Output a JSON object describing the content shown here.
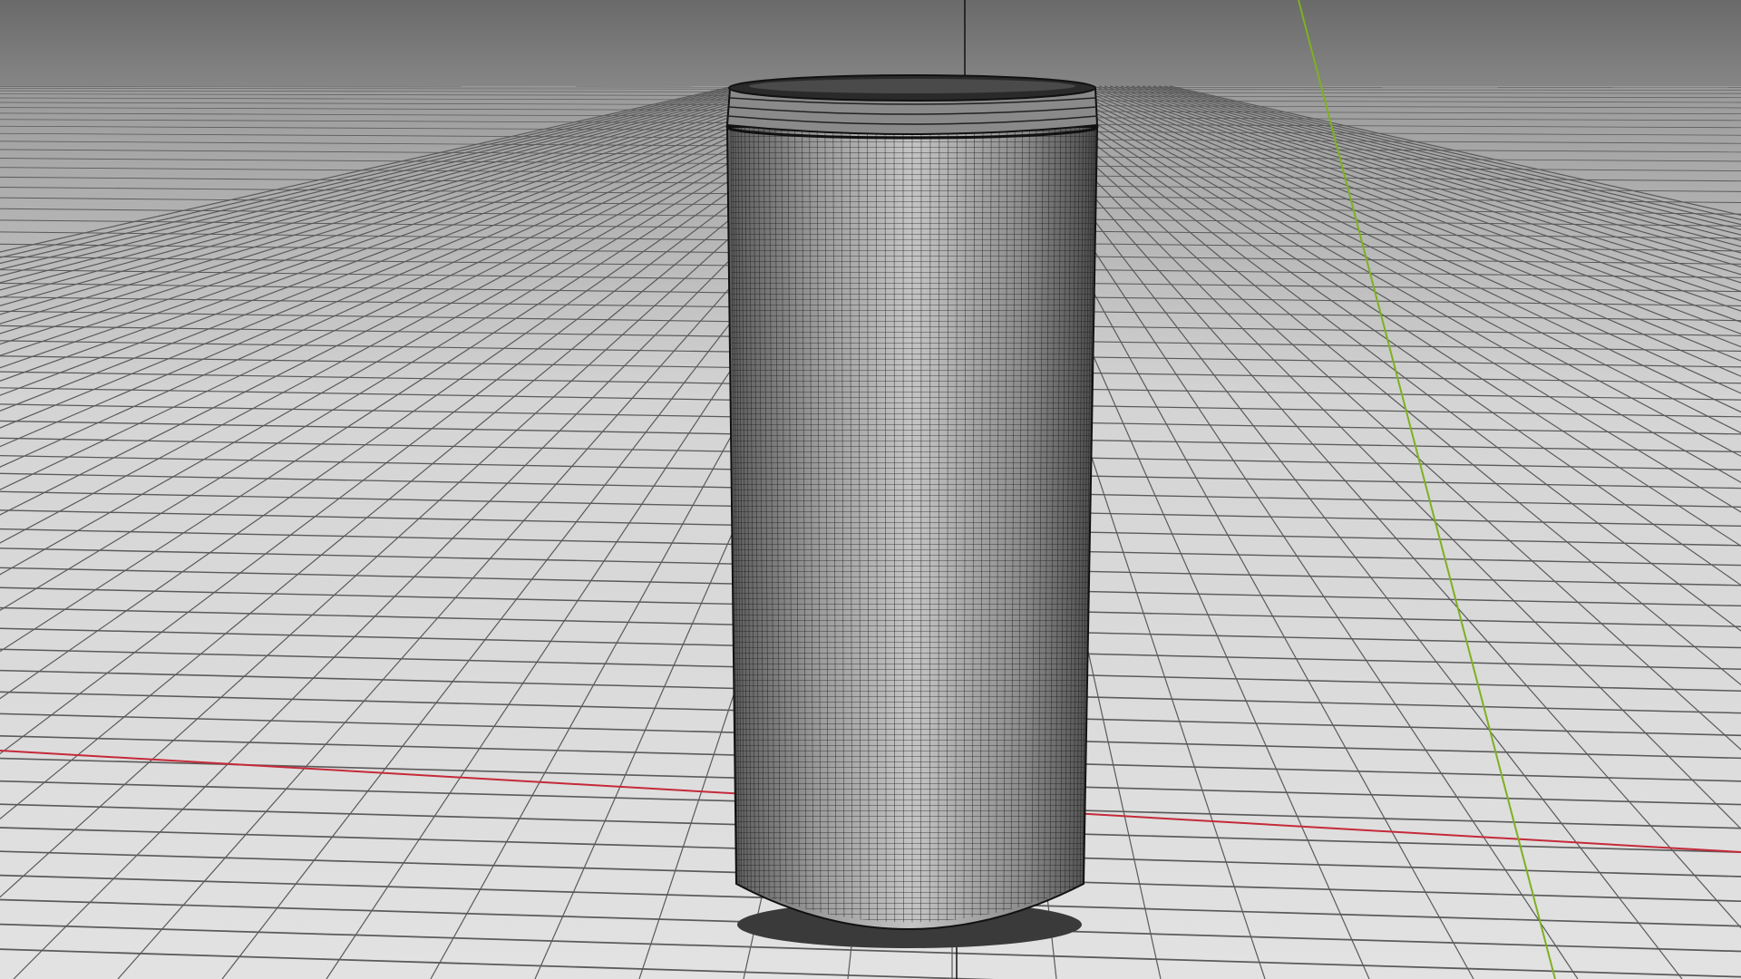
{
  "viewport": {
    "view": "perspective",
    "shading": "wireframe-on-shaded",
    "grid": true,
    "axes_visible": [
      "x",
      "y",
      "z"
    ],
    "colors": {
      "sky": "#6b6b6b",
      "floor": "#dcdcdc",
      "grid_line": "#5a5a5a",
      "x_axis": "#c42a3a",
      "y_axis": "#7fb020",
      "z_axis": "#111111",
      "mesh_fill": "#9a9a9a",
      "mesh_wire": "#1a1a1a"
    }
  },
  "scene": {
    "objects": [
      {
        "name": "can",
        "kind": "cylinder-mesh",
        "selected": false
      }
    ]
  }
}
